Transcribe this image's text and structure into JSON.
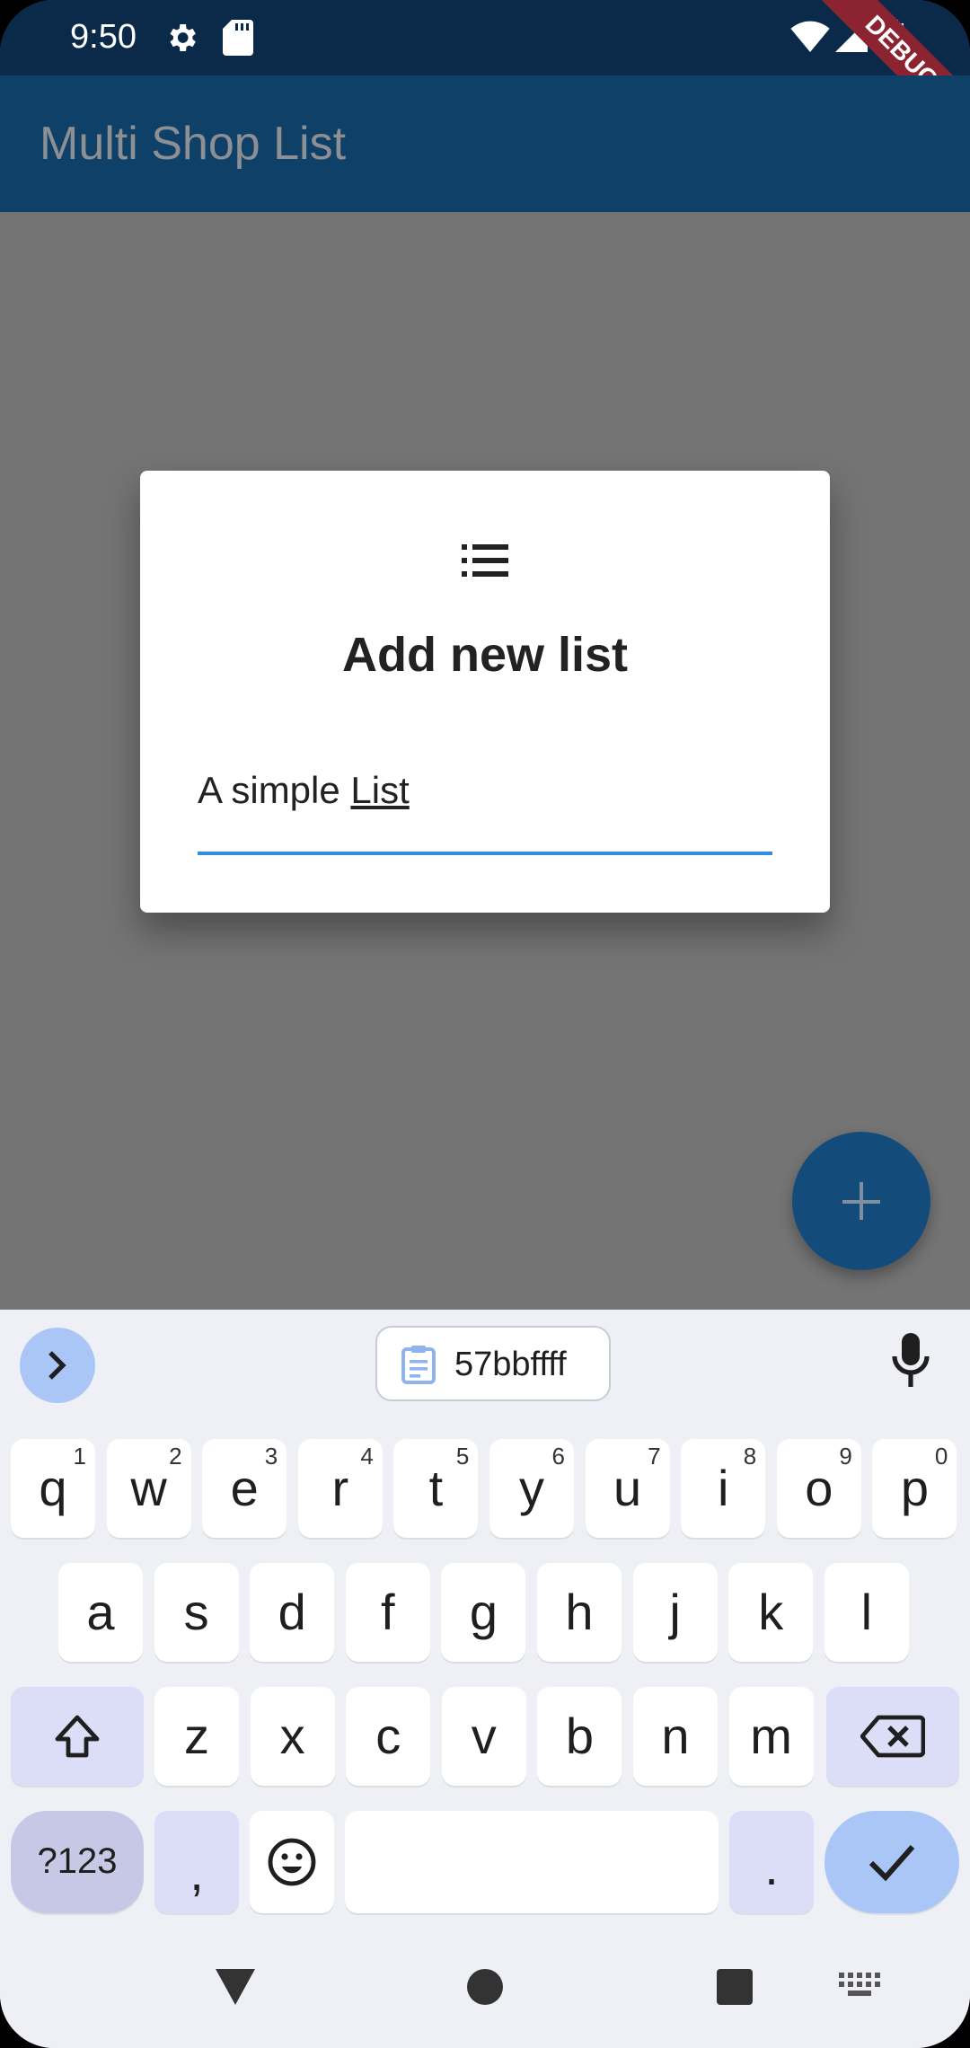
{
  "status_bar": {
    "time": "9:50",
    "debug_label": "DEBUG"
  },
  "app_bar": {
    "title": "Multi Shop List"
  },
  "dialog": {
    "title": "Add new list",
    "input_value": "A simple List",
    "input_text_plain": "A simple ",
    "input_text_underlined": "List"
  },
  "keyboard": {
    "clipboard_text": "57bbffff",
    "row1": [
      {
        "key": "q",
        "hint": "1"
      },
      {
        "key": "w",
        "hint": "2"
      },
      {
        "key": "e",
        "hint": "3"
      },
      {
        "key": "r",
        "hint": "4"
      },
      {
        "key": "t",
        "hint": "5"
      },
      {
        "key": "y",
        "hint": "6"
      },
      {
        "key": "u",
        "hint": "7"
      },
      {
        "key": "i",
        "hint": "8"
      },
      {
        "key": "o",
        "hint": "9"
      },
      {
        "key": "p",
        "hint": "0"
      }
    ],
    "row2": [
      "a",
      "s",
      "d",
      "f",
      "g",
      "h",
      "j",
      "k",
      "l"
    ],
    "row3": [
      "z",
      "x",
      "c",
      "v",
      "b",
      "n",
      "m"
    ],
    "symbols_label": "?123",
    "comma_label": ",",
    "period_label": "."
  },
  "colors": {
    "status_bar": "#0b2a4a",
    "app_bar": "#0f4168",
    "scrim": "#747474",
    "accent": "#2e8fe0",
    "fab": "#134c7b"
  }
}
